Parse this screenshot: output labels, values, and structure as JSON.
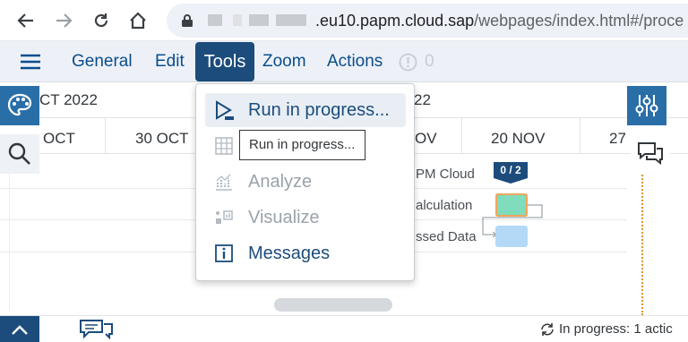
{
  "browser": {
    "url_domain": ".eu10.papm.cloud.sap",
    "url_path": "/webpages/index.html#/proce"
  },
  "shell": {
    "menu": [
      "General",
      "Edit",
      "Tools",
      "Zoom",
      "Actions"
    ],
    "actions_count": "0"
  },
  "gantt": {
    "months": [
      "CT 2022",
      "22"
    ],
    "days": [
      "OCT",
      "30 OCT",
      "OV",
      "20 NOV",
      "27"
    ],
    "rows": [
      "PM Cloud",
      "alculation",
      "ssed Data"
    ],
    "badge": "0 / 2",
    "colors": {
      "green_block": "#7fdcbc",
      "blue_block": "#b3d9f7",
      "badge": "#1c4c7c"
    }
  },
  "tools_menu": {
    "items": [
      {
        "label": "Run in progress...",
        "icon": "play-icon",
        "enabled": true,
        "hovered": true
      },
      {
        "label": "",
        "icon": "grid-icon",
        "enabled": false
      },
      {
        "label": "Analyze",
        "icon": "analyze-icon",
        "enabled": false
      },
      {
        "label": "Visualize",
        "icon": "visualize-icon",
        "enabled": false
      },
      {
        "label": "Messages",
        "icon": "info-icon",
        "enabled": true
      }
    ],
    "tooltip": "Run in progress..."
  },
  "status": {
    "text": "In progress: 1 actic"
  }
}
